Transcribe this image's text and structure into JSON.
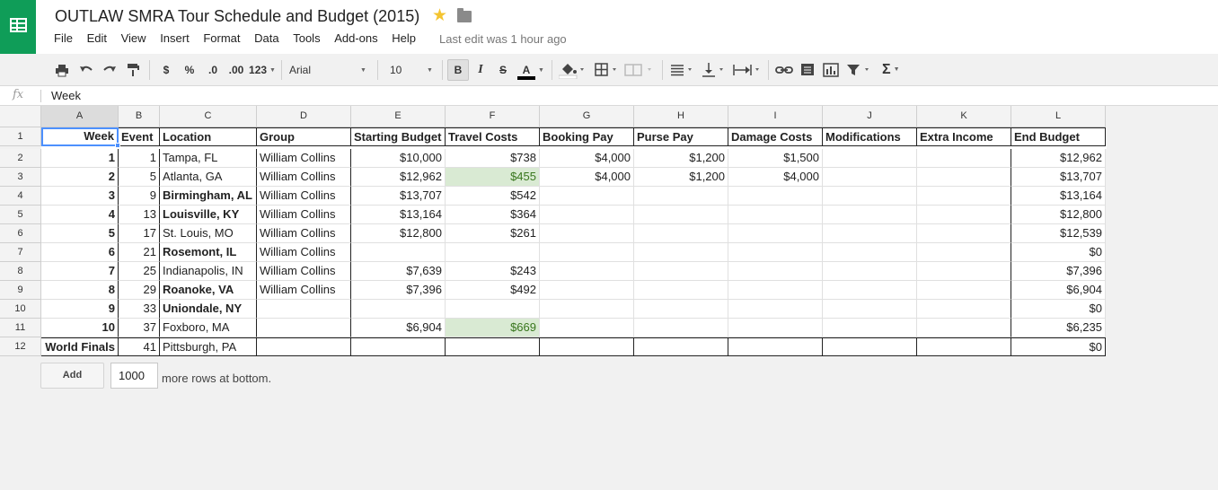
{
  "header": {
    "title": "OUTLAW SMRA Tour Schedule and Budget (2015)",
    "menu": [
      "File",
      "Edit",
      "View",
      "Insert",
      "Format",
      "Data",
      "Tools",
      "Add-ons",
      "Help"
    ],
    "last_edit": "Last edit was 1 hour ago"
  },
  "toolbar": {
    "currency": "$",
    "percent": "%",
    "decimal_decrease": ".0",
    "decimal_increase": ".00",
    "more_formats": "123",
    "font": "Arial",
    "font_size": "10",
    "bold": "B",
    "italic": "I",
    "strike": "S",
    "text_color": "A",
    "functions": "Σ"
  },
  "formula_bar": {
    "fx": "fx",
    "value": "Week"
  },
  "columns": [
    "A",
    "B",
    "C",
    "D",
    "E",
    "F",
    "G",
    "H",
    "I",
    "J",
    "K",
    "L"
  ],
  "selected_column": "A",
  "header_row": [
    "Week",
    "Event",
    "Location",
    "Group",
    "Starting Budget",
    "Travel Costs",
    "Booking Pay",
    "Purse Pay",
    "Damage Costs",
    "Modifications",
    "Extra Income",
    "End Budget"
  ],
  "rows": [
    {
      "num": "1",
      "cells": [
        "Week",
        "Event",
        "Location",
        "Group",
        "Starting Budget",
        "Travel Costs",
        "Booking Pay",
        "Purse Pay",
        "Damage Costs",
        "Modifications",
        "Extra Income",
        "End Budget"
      ]
    },
    {
      "num": "2",
      "cells": [
        "1",
        "1",
        "Tampa, FL",
        "William Collins",
        "$10,000",
        "$738",
        "$4,000",
        "$1,200",
        "$1,500",
        "",
        "",
        "$12,962"
      ]
    },
    {
      "num": "3",
      "cells": [
        "2",
        "5",
        "Atlanta, GA",
        "William Collins",
        "$12,962",
        "$455",
        "$4,000",
        "$1,200",
        "$4,000",
        "",
        "",
        "$13,707"
      ]
    },
    {
      "num": "4",
      "cells": [
        "3",
        "9",
        "Birmingham, AL",
        "William Collins",
        "$13,707",
        "$542",
        "",
        "",
        "",
        "",
        "",
        "$13,164"
      ]
    },
    {
      "num": "5",
      "cells": [
        "4",
        "13",
        "Louisville, KY",
        "William Collins",
        "$13,164",
        "$364",
        "",
        "",
        "",
        "",
        "",
        "$12,800"
      ]
    },
    {
      "num": "6",
      "cells": [
        "5",
        "17",
        "St. Louis, MO",
        "William Collins",
        "$12,800",
        "$261",
        "",
        "",
        "",
        "",
        "",
        "$12,539"
      ]
    },
    {
      "num": "7",
      "cells": [
        "6",
        "21",
        "Rosemont, IL",
        "William Collins",
        "",
        "",
        "",
        "",
        "",
        "",
        "",
        "$0"
      ]
    },
    {
      "num": "8",
      "cells": [
        "7",
        "25",
        "Indianapolis, IN",
        "William Collins",
        "$7,639",
        "$243",
        "",
        "",
        "",
        "",
        "",
        "$7,396"
      ]
    },
    {
      "num": "9",
      "cells": [
        "8",
        "29",
        "Roanoke, VA",
        "William Collins",
        "$7,396",
        "$492",
        "",
        "",
        "",
        "",
        "",
        "$6,904"
      ]
    },
    {
      "num": "10",
      "cells": [
        "9",
        "33",
        "Uniondale, NY",
        "",
        "",
        "",
        "",
        "",
        "",
        "",
        "",
        "$0"
      ]
    },
    {
      "num": "11",
      "cells": [
        "10",
        "37",
        "Foxboro, MA",
        "",
        "$6,904",
        "$669",
        "",
        "",
        "",
        "",
        "",
        "$6,235"
      ]
    },
    {
      "num": "12",
      "cells": [
        "World Finals",
        "41",
        "Pittsburgh, PA",
        "",
        "",
        "",
        "",
        "",
        "",
        "",
        "",
        "$0"
      ]
    }
  ],
  "bold_locations": [
    "Birmingham, AL",
    "Louisville, KY",
    "Rosemont, IL",
    "Roanoke, VA",
    "Uniondale, NY"
  ],
  "highlight_color": "#d9ead3",
  "footer": {
    "add_label": "Add",
    "rows_value": "1000",
    "rows_suffix": "more rows at bottom."
  },
  "colors": {
    "brand": "#0f9d58",
    "star": "#f4c430"
  },
  "icons": [
    "sheets-logo-icon",
    "star-icon",
    "folder-icon",
    "print-icon",
    "undo-icon",
    "redo-icon",
    "paint-format-icon",
    "fill-color-icon",
    "borders-icon",
    "merge-icon",
    "align-icon",
    "valign-icon",
    "wrap-icon",
    "link-icon",
    "comment-icon",
    "chart-icon",
    "filter-icon"
  ]
}
